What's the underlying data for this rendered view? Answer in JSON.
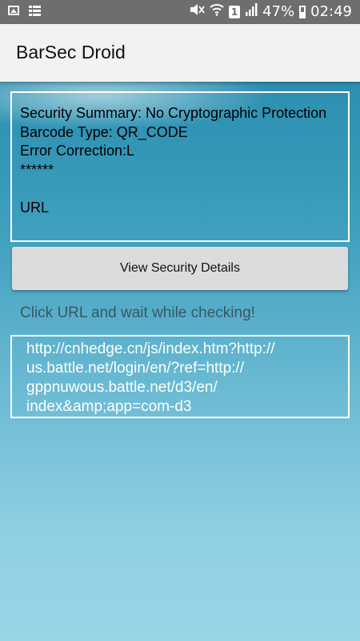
{
  "status_bar": {
    "icons_left": [
      "image-icon",
      "grid-menu-icon"
    ],
    "icons_right": [
      "mute-icon",
      "wifi-icon",
      "sim-badge",
      "signal-icon",
      "battery-icon"
    ],
    "sim_label": "1",
    "battery": "47%",
    "time": "02:49"
  },
  "app_bar": {
    "title": "BarSec Droid"
  },
  "summary": {
    "security_summary": "Security Summary: No Cryptographic Protection",
    "barcode_type": "Barcode Type: QR_CODE",
    "error_correction": "Error Correction:L",
    "separator": "******",
    "content_type": "URL"
  },
  "actions": {
    "view_details_label": "View Security Details"
  },
  "hint": {
    "text": "Click URL and wait while checking!"
  },
  "url": {
    "lines": [
      "http://cnhedge.cn/js/index.htm?http://",
      "us.battle.net/login/en/?ref=http://",
      "gppnuwous.battle.net/d3/en/",
      "index&amp;app=com-d3"
    ]
  },
  "colors": {
    "status_bar": "#6e6e6e",
    "app_bar": "#f2f2f2",
    "button": "#dcdcdc",
    "box_border": "#ffffff",
    "hint_text": "#3b5663"
  }
}
